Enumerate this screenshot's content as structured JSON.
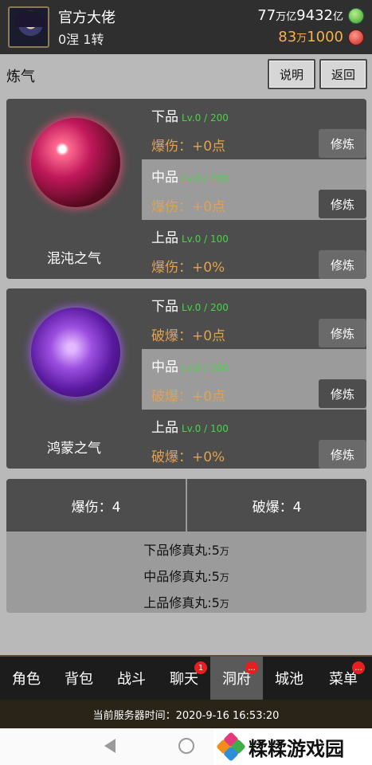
{
  "header": {
    "player_name": "官方大佬",
    "rank": "0涅 1转",
    "money1": {
      "a": "77",
      "a_unit": "万亿",
      "b": "9432",
      "b_unit": "亿"
    },
    "money2": {
      "a": "83",
      "a_unit": "万",
      "b": "1000"
    },
    "icons": {
      "coin": "green-coin-icon",
      "gem": "red-gem-icon"
    }
  },
  "titlebar": {
    "title": "炼气",
    "info_button": "说明",
    "back_button": "返回"
  },
  "cards": [
    {
      "name": "混沌之气",
      "rows": [
        {
          "grade": "下品",
          "level": "Lv.0 / 200",
          "stat": "爆伤：+0点",
          "button": "修炼"
        },
        {
          "grade": "中品",
          "level": "Lv.0 / 200",
          "stat": "爆伤：+0点",
          "button": "修炼"
        },
        {
          "grade": "上品",
          "level": "Lv.0 / 100",
          "stat": "爆伤：+0%",
          "button": "修炼"
        }
      ]
    },
    {
      "name": "鸿蒙之气",
      "rows": [
        {
          "grade": "下品",
          "level": "Lv.0 / 200",
          "stat": "破爆：+0点",
          "button": "修炼"
        },
        {
          "grade": "中品",
          "level": "Lv.0 / 200",
          "stat": "破爆：+0点",
          "button": "修炼"
        },
        {
          "grade": "上品",
          "level": "Lv.0 / 100",
          "stat": "破爆：+0%",
          "button": "修炼"
        }
      ]
    }
  ],
  "summary": {
    "crit_damage": "爆伤：4",
    "crit_break": "破爆：4",
    "pills": [
      {
        "label": "下品修真丸:5",
        "unit": "万"
      },
      {
        "label": "中品修真丸:5",
        "unit": "万"
      },
      {
        "label": "上品修真丸:5",
        "unit": "万"
      }
    ]
  },
  "nav": {
    "items": [
      {
        "label": "角色",
        "badge": ""
      },
      {
        "label": "背包",
        "badge": ""
      },
      {
        "label": "战斗",
        "badge": ""
      },
      {
        "label": "聊天",
        "badge": "1"
      },
      {
        "label": "洞府",
        "badge": "..."
      },
      {
        "label": "城池",
        "badge": ""
      },
      {
        "label": "菜单",
        "badge": "..."
      }
    ],
    "active": "洞府"
  },
  "server_time": "当前服务器时间：2020-9-16 16:53:20",
  "watermark_logo": "糅糅游戏园"
}
